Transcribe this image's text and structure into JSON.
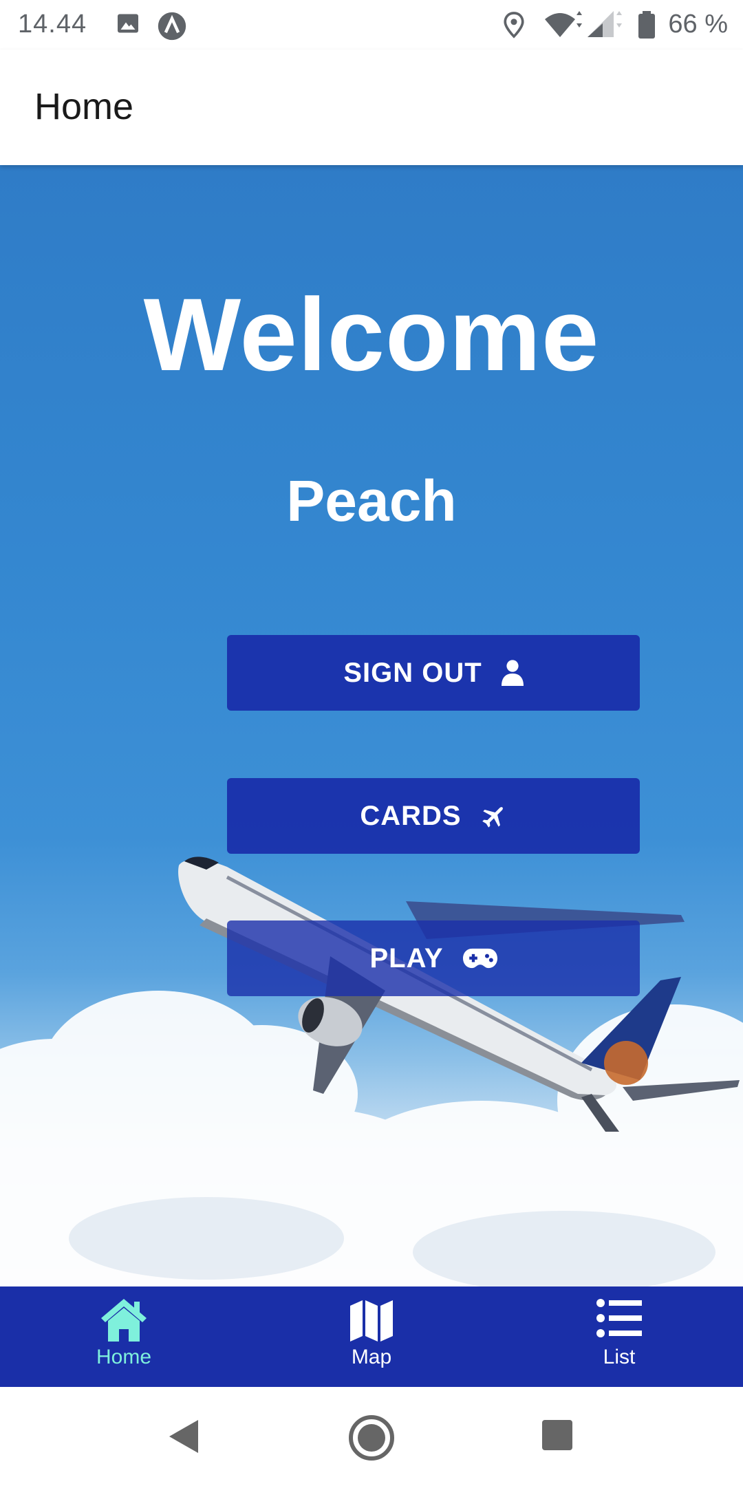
{
  "status_bar": {
    "time": "14.44",
    "battery_text": "66 %",
    "icons": [
      "image-icon",
      "app-notification-icon",
      "location-icon",
      "wifi-icon",
      "signal-icon",
      "battery-icon"
    ]
  },
  "app_bar": {
    "title": "Home"
  },
  "hero": {
    "welcome_text": "Welcome",
    "user_name": "Peach",
    "background": "airplane-in-blue-sky-image"
  },
  "buttons": {
    "sign_out": {
      "label": "SIGN OUT",
      "icon": "user-icon"
    },
    "cards": {
      "label": "CARDS",
      "icon": "plane-icon"
    },
    "play": {
      "label": "PLAY",
      "icon": "gamepad-icon"
    }
  },
  "bottom_nav": {
    "items": [
      {
        "label": "Home",
        "icon": "home-icon",
        "active": true
      },
      {
        "label": "Map",
        "icon": "map-icon",
        "active": false
      },
      {
        "label": "List",
        "icon": "list-icon",
        "active": false
      }
    ]
  },
  "colors": {
    "button_bg": "#1a2fa8",
    "active_tab": "#7ff0dc",
    "sky": "#3487d0"
  }
}
